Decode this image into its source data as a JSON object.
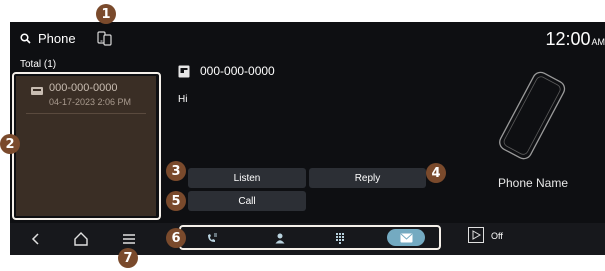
{
  "search": {
    "label": "Phone"
  },
  "status": {
    "time": "12:00",
    "ampm": "AM"
  },
  "list": {
    "total_label": "Total (1)",
    "items": [
      {
        "number": "000-000-0000",
        "datetime": "04-17-2023 2:06 PM"
      }
    ]
  },
  "detail": {
    "number": "000-000-0000",
    "message": "Hi",
    "buttons": {
      "listen": "Listen",
      "reply": "Reply",
      "call": "Call"
    }
  },
  "device": {
    "name": "Phone Name"
  },
  "bottom": {
    "tabs": [
      "recents-icon",
      "contacts-icon",
      "keypad-icon",
      "messages-icon"
    ],
    "active_tab": "messages-icon",
    "media_status": "Off"
  },
  "callouts": [
    "1",
    "2",
    "3",
    "4",
    "5",
    "6",
    "7"
  ],
  "colors": {
    "accent": "#74aac1",
    "callout": "#7a4a2c",
    "list_item_bg": "#3a2e25"
  }
}
